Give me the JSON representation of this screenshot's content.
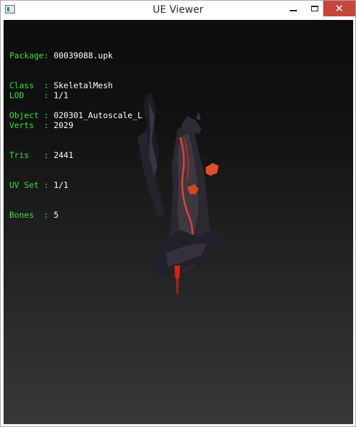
{
  "window": {
    "title": "UE Viewer",
    "icon": "app-icon",
    "controls": {
      "minimize": "minimize-icon",
      "maximize": "maximize-icon",
      "close": "close-icon",
      "close_glyph": "✕"
    }
  },
  "info": {
    "package": {
      "key": "Package:",
      "value": "00039088.upk"
    },
    "class": {
      "key": "Class  :",
      "value": "SkeletalMesh"
    },
    "object": {
      "key": "Object :",
      "value": "020301_Autoscale_L"
    },
    "lod": {
      "key": "LOD    :",
      "value": "1/1"
    },
    "verts": {
      "key": "Verts  :",
      "value": "2029"
    },
    "tris": {
      "key": "Tris   :",
      "value": "2441"
    },
    "uvset": {
      "key": "UV Set :",
      "value": "1/1"
    },
    "bones": {
      "key": "Bones  :",
      "value": "5"
    }
  },
  "colors": {
    "label": "#36e03a",
    "value": "#ffffff",
    "close_button": "#c7463a"
  }
}
